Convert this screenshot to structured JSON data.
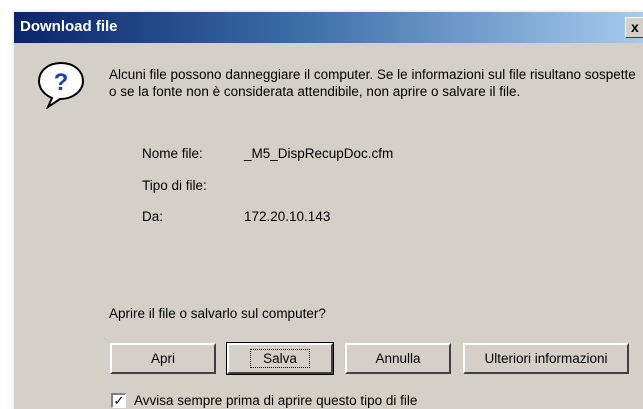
{
  "window": {
    "title": "Download file",
    "close_glyph": "x"
  },
  "icon": {
    "name": "question-icon",
    "glyph": "?",
    "color": "#1a3fb0"
  },
  "message": "Alcuni file possono danneggiare il computer. Se le informazioni sul file risultano sospette o se la fonte non è considerata attendibile, non aprire o salvare il file.",
  "file_info": {
    "name_label": "Nome file:",
    "name_value": "_M5_DispRecupDoc.cfm",
    "type_label": "Tipo di file:",
    "type_value": "",
    "from_label": "Da:",
    "from_value": "172.20.10.143"
  },
  "prompt": "Aprire il file o salvarlo sul computer?",
  "buttons": {
    "open": "Apri",
    "save": "Salva",
    "cancel": "Annulla",
    "more_info": "Ulteriori informazioni"
  },
  "checkbox": {
    "checked": true,
    "label": "Avvisa sempre prima di aprire questo tipo di file"
  }
}
